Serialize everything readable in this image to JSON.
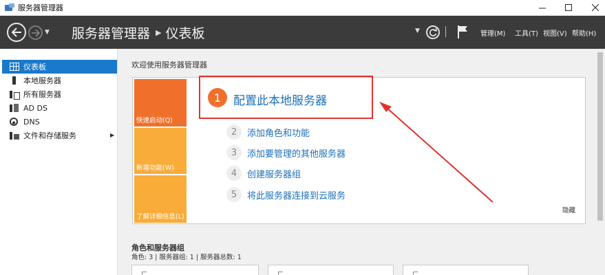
{
  "window": {
    "title": "服务器管理器"
  },
  "header": {
    "breadcrumb_root": "服务器管理器",
    "breadcrumb_current": "仪表板",
    "menu": {
      "manage": "管理(M)",
      "tools": "工具(T)",
      "view": "视图(V)",
      "help": "帮助(H)"
    }
  },
  "sidebar": {
    "items": [
      {
        "label": "仪表板",
        "icon": "dashboard-icon",
        "active": true
      },
      {
        "label": "本地服务器",
        "icon": "local-server-icon"
      },
      {
        "label": "所有服务器",
        "icon": "all-servers-icon"
      },
      {
        "label": "AD DS",
        "icon": "ad-ds-icon"
      },
      {
        "label": "DNS",
        "icon": "dns-icon"
      },
      {
        "label": "文件和存储服务",
        "icon": "file-storage-icon",
        "has_submenu": true
      }
    ]
  },
  "main": {
    "welcome": "欢迎使用服务器管理器",
    "tiles": {
      "quick_start": "快速启动(Q)",
      "whats_new": "新增功能(W)",
      "learn_more": "了解详细信息(L)"
    },
    "steps": [
      {
        "num": "1",
        "label": "配置此本地服务器"
      },
      {
        "num": "2",
        "label": "添加角色和功能"
      },
      {
        "num": "3",
        "label": "添加要管理的其他服务器"
      },
      {
        "num": "4",
        "label": "创建服务器组"
      },
      {
        "num": "5",
        "label": "将此服务器连接到云服务"
      }
    ],
    "hide": "隐藏",
    "roles_title": "角色和服务器组",
    "roles_summary": "角色: 3 | 服务器组: 1 | 服务器总数: 1"
  },
  "colors": {
    "header_bg": "#3b3b3b",
    "accent_orange": "#f0702b",
    "tile_yellow": "#f9ac3a",
    "link_blue": "#1c6fb8",
    "selection_blue": "#1979ca",
    "annotation_red": "#e0312d"
  }
}
